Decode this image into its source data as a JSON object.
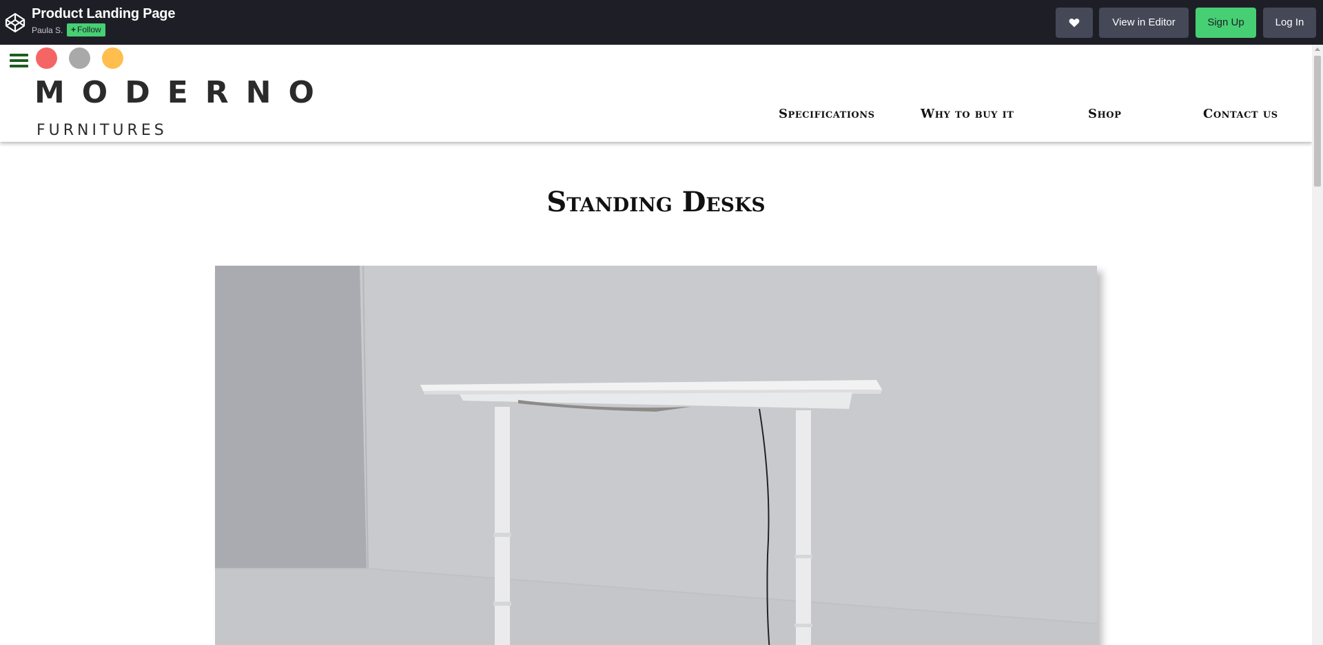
{
  "codepen": {
    "title": "Product Landing Page",
    "author": "Paula S.",
    "follow_label": "Follow",
    "heart_icon": "heart-icon",
    "view_editor_label": "View in Editor",
    "signup_label": "Sign Up",
    "login_label": "Log In",
    "colors": {
      "bar": "#1e1f26",
      "button": "#444857",
      "accent": "#47cf73"
    }
  },
  "site": {
    "logo_main": "MODERNO",
    "logo_sub": "FURNITURES",
    "dots": [
      "#f56565",
      "#a9a9a9",
      "#ffbe4d"
    ],
    "nav": [
      {
        "label": "Specifications"
      },
      {
        "label": "Why to buy it"
      },
      {
        "label": "Shop"
      },
      {
        "label": "Contact us"
      }
    ]
  },
  "main": {
    "title": "Standing Desks",
    "hero_image": "standing-desk-photo"
  }
}
